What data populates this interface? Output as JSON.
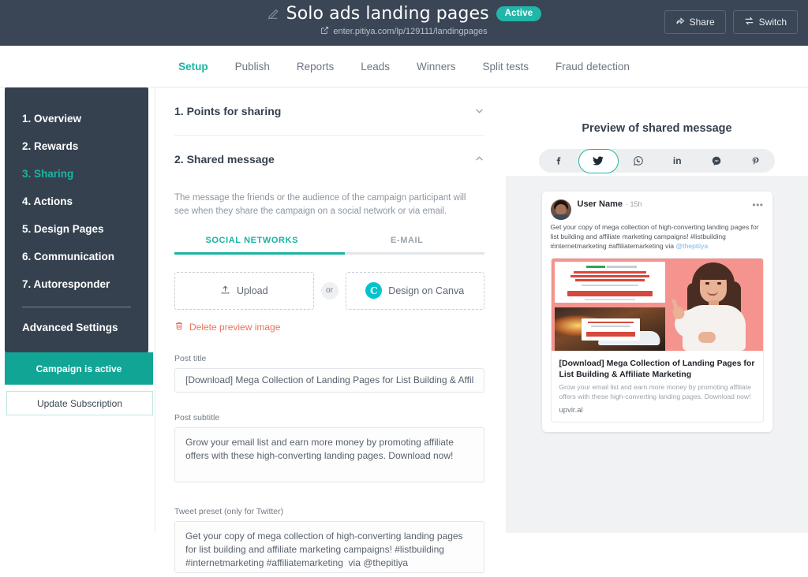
{
  "header": {
    "edit_icon": "pencil-icon",
    "title": "Solo ads landing pages",
    "status_badge": "Active",
    "link_icon": "external-link-icon",
    "url": "enter.pitiya.com/lp/129111/landingpages",
    "share_button": "Share",
    "switch_button": "Switch",
    "bg_color": "#3a4656",
    "accent_color": "#21b6a8"
  },
  "tabs": [
    {
      "label": "Setup",
      "active": true
    },
    {
      "label": "Publish",
      "active": false
    },
    {
      "label": "Reports",
      "active": false
    },
    {
      "label": "Leads",
      "active": false
    },
    {
      "label": "Winners",
      "active": false
    },
    {
      "label": "Split tests",
      "active": false
    },
    {
      "label": "Fraud detection",
      "active": false
    }
  ],
  "sidebar": {
    "items": [
      {
        "label": "1. Overview",
        "active": false
      },
      {
        "label": "2. Rewards",
        "active": false
      },
      {
        "label": "3. Sharing",
        "active": true
      },
      {
        "label": "4. Actions",
        "active": false
      },
      {
        "label": "5. Design Pages",
        "active": false
      },
      {
        "label": "6. Communication",
        "active": false
      },
      {
        "label": "7. Autoresponder",
        "active": false
      }
    ],
    "advanced_settings": "Advanced Settings",
    "campaign_status_button": "Campaign is active",
    "update_subscription_button": "Update Subscription",
    "bg_color": "#36414f",
    "status_color": "#11a596"
  },
  "main": {
    "section1": {
      "title": "1. Points for sharing",
      "chevron": "chevron-down-icon",
      "expanded": false
    },
    "section2": {
      "title": "2. Shared message",
      "chevron": "chevron-up-icon",
      "expanded": true,
      "description": "The message the friends or the audience of the campaign participant will see when they share the campaign on a social network or via email.",
      "subtabs": [
        {
          "label": "SOCIAL NETWORKS",
          "active": true
        },
        {
          "label": "E-MAIL",
          "active": false
        }
      ],
      "upload_button": "Upload",
      "upload_icon": "upload-icon",
      "or_separator": "or",
      "canva_button": "Design on Canva",
      "canva_icon": "canva-icon",
      "delete_link": "Delete preview image",
      "delete_icon": "trash-icon",
      "fields": [
        {
          "label": "Post title",
          "value": "[Download] Mega Collection of Landing Pages for List Building & Affiliate"
        },
        {
          "label": "Post subtitle",
          "value": "Grow your email list and earn more money by promoting affiliate offers with these high-converting landing pages. Download now!"
        },
        {
          "label": "Tweet preset (only for Twitter)",
          "value": "Get your copy of mega collection of high-converting landing pages for list building and affiliate marketing campaigns! #listbuilding #internetmarketing #affiliatemarketing  via @thepitiya"
        }
      ]
    }
  },
  "preview": {
    "title": "Preview of shared message",
    "networks": [
      {
        "name": "facebook-icon",
        "glyph": "f",
        "selected": false
      },
      {
        "name": "twitter-icon",
        "glyph": "bird",
        "selected": true
      },
      {
        "name": "whatsapp-icon",
        "glyph": "whatsapp",
        "selected": false
      },
      {
        "name": "linkedin-icon",
        "glyph": "in",
        "selected": false
      },
      {
        "name": "messenger-icon",
        "glyph": "messenger",
        "selected": false
      },
      {
        "name": "pinterest-icon",
        "glyph": "P",
        "selected": false
      }
    ],
    "selected_color": "#23b5a4",
    "tweet": {
      "user_name": "User Name",
      "timestamp": "15h",
      "more_icon": "ellipsis-icon",
      "body_text": "Get your copy of mega collection of high-converting landing pages for list building and affiliate marketing campaigns! #listbuilding #internetmarketing #affiliatemarketing via ",
      "mention": "@thepitiya",
      "card": {
        "title": "[Download] Mega Collection of Landing Pages for List Building & Affiliate Marketing",
        "description": "Grow your email list and earn more money by promoting affiliate offers with these high-converting landing pages. Download now!",
        "domain": "upvir.al"
      }
    }
  }
}
